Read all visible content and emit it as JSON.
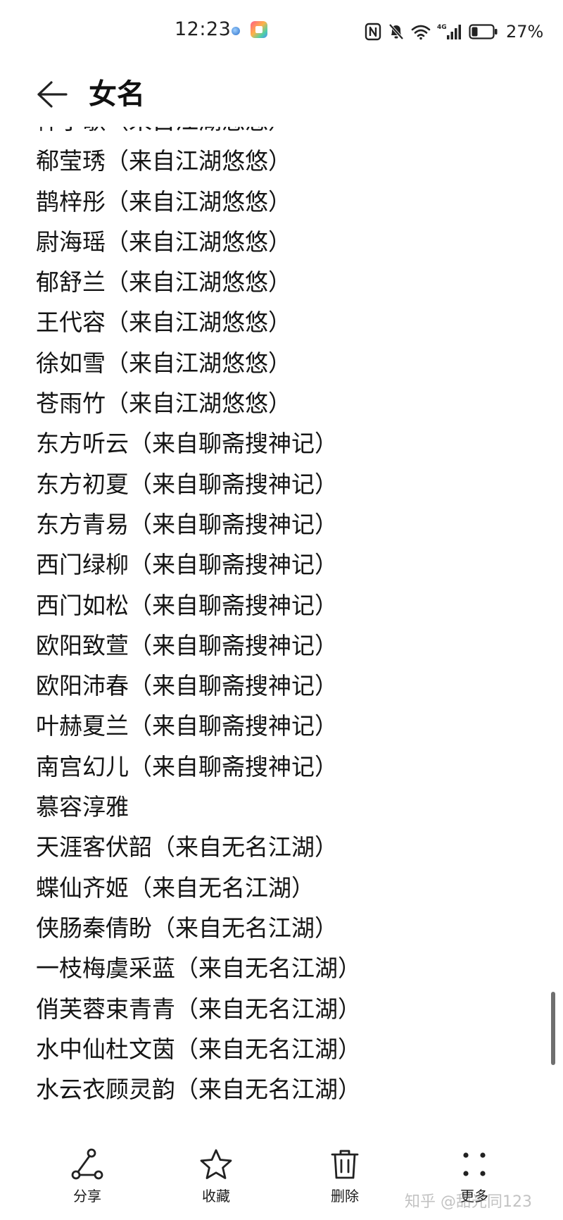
{
  "status_bar": {
    "time": "12:23",
    "network": "4G",
    "battery_percent": "27%",
    "icons": [
      "nfc-icon",
      "bell-muted-icon",
      "wifi-icon",
      "signal-icon",
      "battery-icon"
    ]
  },
  "header": {
    "title": "女名",
    "back_icon": "arrow-left-icon"
  },
  "list": {
    "items": [
      "梓子歌（来自江湖悠悠）",
      "郗莹琇（来自江湖悠悠）",
      "鹊梓彤（来自江湖悠悠）",
      "尉海瑶（来自江湖悠悠）",
      "郁舒兰（来自江湖悠悠）",
      "王代容（来自江湖悠悠）",
      "徐如雪（来自江湖悠悠）",
      "苍雨竹（来自江湖悠悠）",
      "东方听云（来自聊斋搜神记）",
      "东方初夏（来自聊斋搜神记）",
      "东方青易（来自聊斋搜神记）",
      "西门绿柳（来自聊斋搜神记）",
      "西门如松（来自聊斋搜神记）",
      "欧阳致萱（来自聊斋搜神记）",
      "欧阳沛春（来自聊斋搜神记）",
      "叶赫夏兰（来自聊斋搜神记）",
      "南宫幻儿（来自聊斋搜神记）",
      "慕容淳雅",
      "天涯客伏韶（来自无名江湖）",
      "蝶仙齐姬（来自无名江湖）",
      "侠肠秦倩盼（来自无名江湖）",
      "一枝梅虞采蓝（来自无名江湖）",
      "俏芙蓉束青青（来自无名江湖）",
      "水中仙杜文茵（来自无名江湖）",
      "水云衣顾灵韵（来自无名江湖）"
    ]
  },
  "toolbar": {
    "share_label": "分享",
    "favorite_label": "收藏",
    "delete_label": "删除",
    "more_label": "更多",
    "icons": [
      "share-icon",
      "star-icon",
      "trash-icon",
      "more-dots-icon"
    ]
  },
  "watermark": "知乎 @甜光同123",
  "colors": {
    "text": "#141414",
    "background": "#ffffff",
    "scrollbar": "#6f6f6f"
  }
}
